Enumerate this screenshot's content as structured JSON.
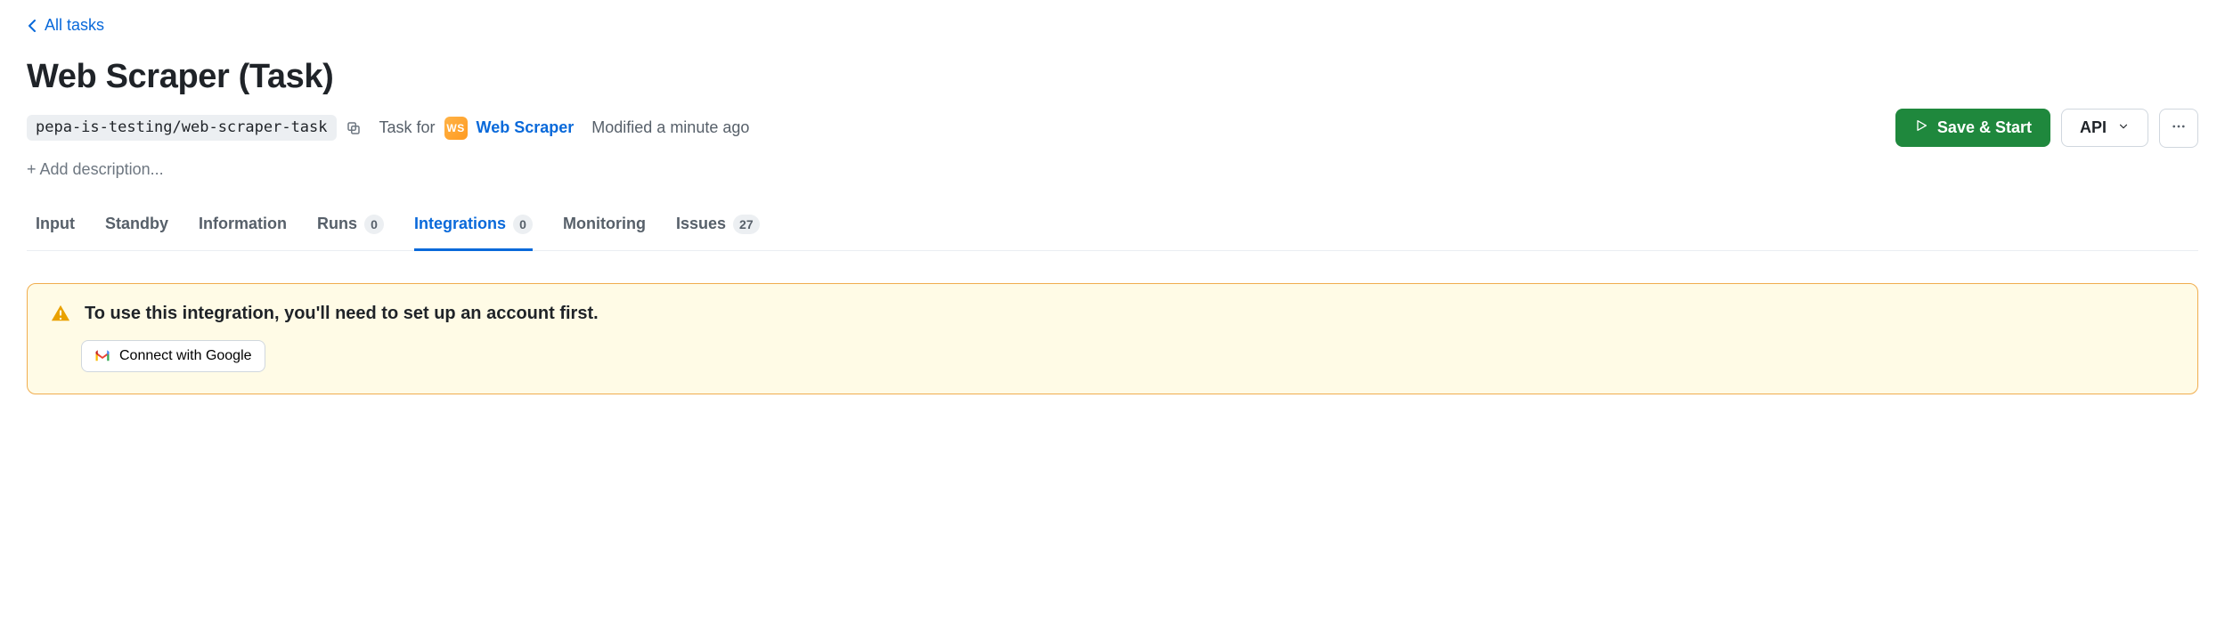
{
  "back_link": {
    "label": "All tasks"
  },
  "title": "Web Scraper (Task)",
  "path": "pepa-is-testing/web-scraper-task",
  "task_for": {
    "label": "Task for",
    "actor_initials": "WS",
    "actor_name": "Web Scraper"
  },
  "modified": "Modified a minute ago",
  "actions": {
    "save_start": "Save & Start",
    "api": "API"
  },
  "add_description": "+ Add description...",
  "tabs": [
    {
      "key": "input",
      "label": "Input"
    },
    {
      "key": "standby",
      "label": "Standby"
    },
    {
      "key": "information",
      "label": "Information"
    },
    {
      "key": "runs",
      "label": "Runs",
      "count": "0"
    },
    {
      "key": "integrations",
      "label": "Integrations",
      "count": "0",
      "active": true
    },
    {
      "key": "monitoring",
      "label": "Monitoring"
    },
    {
      "key": "issues",
      "label": "Issues",
      "count": "27"
    }
  ],
  "warning": {
    "title": "To use this integration, you'll need to set up an account first.",
    "connect_label": "Connect with Google"
  }
}
